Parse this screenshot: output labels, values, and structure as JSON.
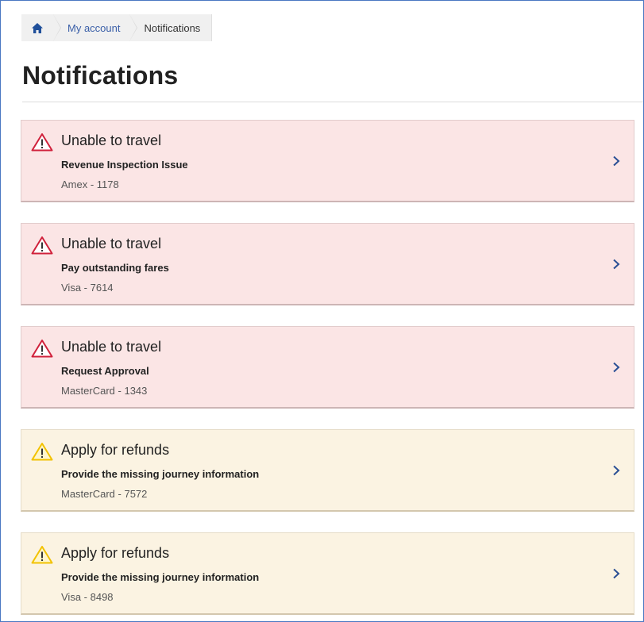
{
  "breadcrumb": {
    "home_icon": "home-icon",
    "items": [
      "My account",
      "Notifications"
    ]
  },
  "page": {
    "title": "Notifications"
  },
  "colors": {
    "error_bg": "#fbe5e5",
    "warning_bg": "#fbf3e2",
    "error_icon": "#d0213b",
    "warning_icon": "#f2c200",
    "link": "#3a5fa8"
  },
  "notifications": [
    {
      "type": "error",
      "icon": "warning-triangle-icon",
      "heading": "Unable to travel",
      "subject": "Revenue Inspection Issue",
      "account": "Amex - 1178"
    },
    {
      "type": "error",
      "icon": "warning-triangle-icon",
      "heading": "Unable to travel",
      "subject": "Pay outstanding fares",
      "account": "Visa - 7614"
    },
    {
      "type": "error",
      "icon": "warning-triangle-icon",
      "heading": "Unable to travel",
      "subject": "Request Approval",
      "account": "MasterCard - 1343"
    },
    {
      "type": "warning",
      "icon": "caution-triangle-icon",
      "heading": "Apply for refunds",
      "subject": "Provide the missing journey information",
      "account": "MasterCard - 7572"
    },
    {
      "type": "warning",
      "icon": "caution-triangle-icon",
      "heading": "Apply for refunds",
      "subject": "Provide the missing journey information",
      "account": "Visa - 8498"
    }
  ]
}
